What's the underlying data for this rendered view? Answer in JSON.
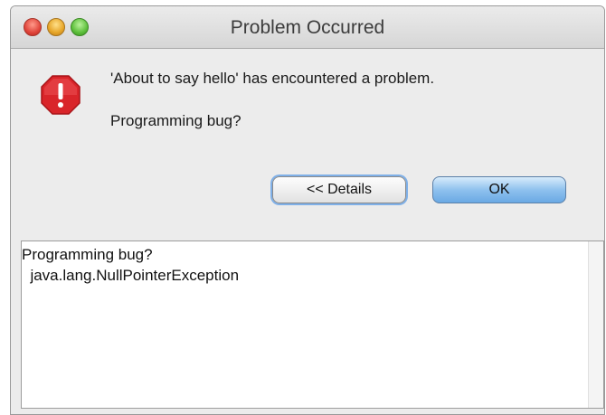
{
  "window": {
    "title": "Problem Occurred"
  },
  "dialog": {
    "icon": "error-stop-icon",
    "message": "'About to say hello' has encountered a problem.",
    "question": "Programming bug?",
    "details_button": "<< Details",
    "ok_button": "OK"
  },
  "details": {
    "line1": "Programming bug?",
    "line2": "  java.lang.NullPointerException"
  },
  "colors": {
    "error_red": "#e0262b",
    "ok_blue": "#8fc1ee"
  }
}
